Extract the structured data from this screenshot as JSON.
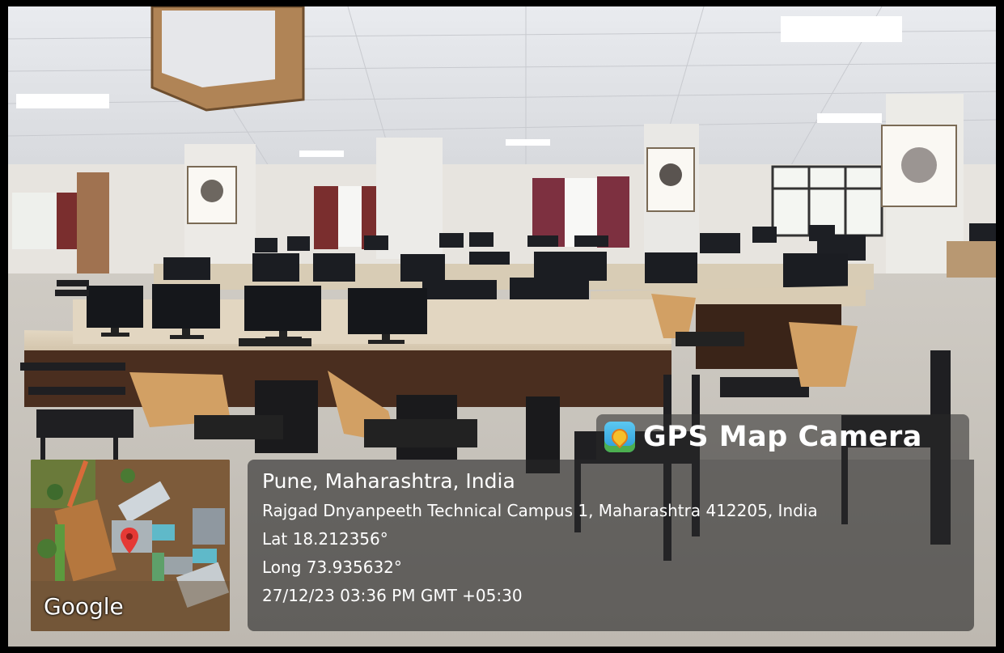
{
  "overlay": {
    "app_name": "GPS Map Camera",
    "app_icon": "map-pin-icon",
    "location_title": "Pune, Maharashtra, India",
    "address": "Rajgad Dnyanpeeth Technical Campus 1, Maharashtra 412205, India",
    "latitude": "Lat 18.212356°",
    "longitude": "Long 73.935632°",
    "datetime": "27/12/23 03:36 PM GMT +05:30"
  },
  "map": {
    "provider_logo": "Google",
    "marker_icon": "map-marker-icon",
    "marker_color": "#e53935"
  },
  "colors": {
    "overlay_bg": "#282828",
    "text": "#ffffff",
    "frame": "#000000"
  }
}
